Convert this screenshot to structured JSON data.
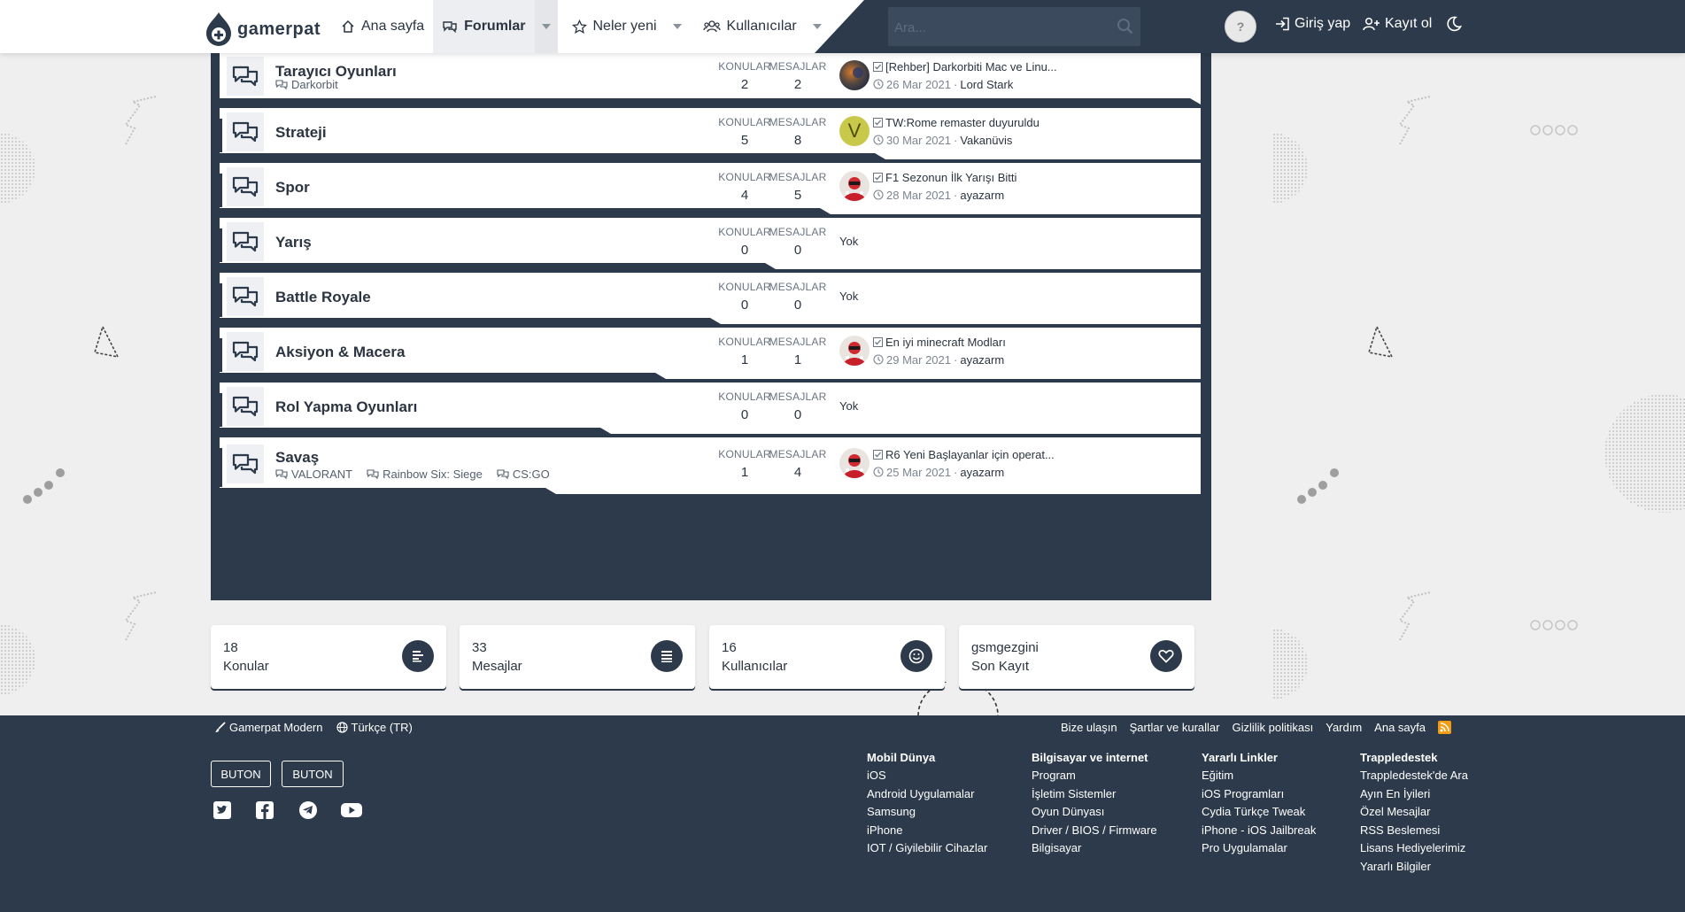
{
  "brand": {
    "name": "gamerpat"
  },
  "nav": {
    "home": "Ana sayfa",
    "forums": "Forumlar",
    "whats_new": "Neler yeni",
    "members": "Kullanıcılar"
  },
  "search": {
    "placeholder": "Ara..."
  },
  "header": {
    "help": "?",
    "login": "Giriş yap",
    "register": "Kayıt ol"
  },
  "stat_labels": {
    "threads": "KONULAR",
    "messages": "MESAJLAR"
  },
  "forums": [
    {
      "title": "Tarayıcı Oyunları",
      "subforums": [
        "Darkorbit"
      ],
      "threads": "2",
      "messages": "2",
      "avatar": "photo-dark",
      "last_title": "[Rehber] Darkorbiti Mac ve Linu...",
      "last_date": "26 Mar 2021",
      "last_user": "Lord Stark"
    },
    {
      "title": "Strateji",
      "subforums": [],
      "threads": "5",
      "messages": "8",
      "avatar": "letter-v",
      "avatar_letter": "V",
      "last_title": "TW:Rome remaster duyuruldu",
      "last_date": "30 Mar 2021",
      "last_user": "Vakanüvis"
    },
    {
      "title": "Spor",
      "subforums": [],
      "threads": "4",
      "messages": "5",
      "avatar": "photo-red",
      "last_title": "F1 Sezonun İlk Yarışı Bitti",
      "last_date": "28 Mar 2021",
      "last_user": "ayazarm"
    },
    {
      "title": "Yarış",
      "subforums": [],
      "threads": "0",
      "messages": "0",
      "none": "Yok"
    },
    {
      "title": "Battle Royale",
      "subforums": [],
      "threads": "0",
      "messages": "0",
      "none": "Yok"
    },
    {
      "title": "Aksiyon & Macera",
      "subforums": [],
      "threads": "1",
      "messages": "1",
      "avatar": "photo-red",
      "last_title": "En iyi minecraft Modları",
      "last_date": "29 Mar 2021",
      "last_user": "ayazarm"
    },
    {
      "title": "Rol Yapma Oyunları",
      "subforums": [],
      "threads": "0",
      "messages": "0",
      "none": "Yok"
    },
    {
      "title": "Savaş",
      "subforums": [
        "VALORANT",
        "Rainbow Six: Siege",
        "CS:GO"
      ],
      "threads": "1",
      "messages": "4",
      "avatar": "photo-red",
      "last_title": "R6 Yeni Başlayanlar için operat...",
      "last_date": "25 Mar 2021",
      "last_user": "ayazarm"
    }
  ],
  "stats": [
    {
      "value": "18",
      "label": "Konular",
      "icon": "list-icon"
    },
    {
      "value": "33",
      "label": "Mesajlar",
      "icon": "lines-icon"
    },
    {
      "value": "16",
      "label": "Kullanıcılar",
      "icon": "smile-icon"
    },
    {
      "value": "gsmgezgini",
      "label": "Son Kayıt",
      "icon": "heart-icon"
    }
  ],
  "footer": {
    "style": "Gamerpat Modern",
    "language": "Türkçe (TR)",
    "links": [
      "Bize ulaşın",
      "Şartlar ve kurallar",
      "Gizlilik politikası",
      "Yardım",
      "Ana sayfa"
    ],
    "buttons": [
      "BUTON",
      "BUTON"
    ],
    "social": [
      "twitter-icon",
      "facebook-icon",
      "telegram-icon",
      "youtube-icon"
    ],
    "columns": [
      {
        "heading": "Mobil Dünya",
        "items": [
          "iOS",
          "Android Uygulamalar",
          "Samsung",
          "iPhone",
          "IOT / Giyilebilir Cihazlar"
        ]
      },
      {
        "heading": "Bilgisayar ve internet",
        "items": [
          "Program",
          "İşletim Sistemler",
          "Oyun Dünyası",
          "Driver / BIOS / Firmware",
          "Bilgisayar"
        ]
      },
      {
        "heading": "Yararlı Linkler",
        "items": [
          "Eğitim",
          "iOS Programları",
          "Cydia Türkçe Tweak",
          "iPhone - iOS Jailbreak",
          "Pro Uygulamalar"
        ]
      },
      {
        "heading": "Trappledestek",
        "items": [
          "Trappledestek'de Ara",
          "Ayın En İyileri",
          "Özel Mesajlar",
          "RSS Beslemesi",
          "Lisans Hediyelerimiz",
          "Yararlı Bilgiler"
        ]
      }
    ]
  },
  "colors": {
    "primary": "#2c3a4b",
    "page_bg": "#f0eff0",
    "rss": "#f39c12"
  }
}
